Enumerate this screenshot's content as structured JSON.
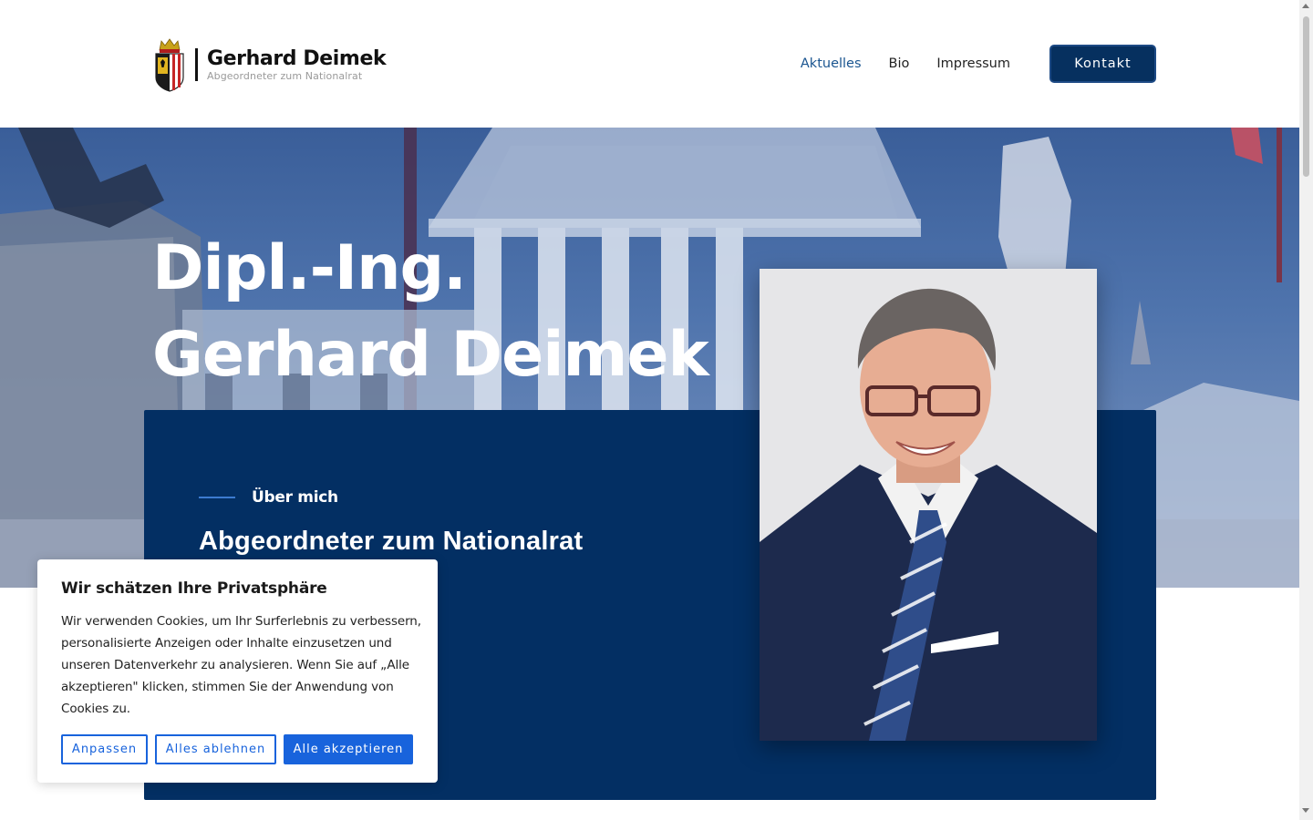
{
  "header": {
    "logo_name": "Gerhard Deimek",
    "logo_subtitle": "Abgeordneter zum Nationalrat",
    "nav": [
      {
        "label": "Aktuelles",
        "active": true
      },
      {
        "label": "Bio",
        "active": false
      },
      {
        "label": "Impressum",
        "active": false
      }
    ],
    "contact_label": "Kontakt"
  },
  "hero": {
    "title_line1": "Dipl.-Ing.",
    "title_line2": "Gerhard Deimek"
  },
  "about": {
    "label": "Über mich",
    "title": "Abgeordneter zum Nationalrat"
  },
  "cookie": {
    "title": "Wir schätzen Ihre Privatsphäre",
    "text": "Wir verwenden Cookies, um Ihr Surferlebnis zu verbessern, personalisierte Anzeigen oder Inhalte einzusetzen und unseren Datenverkehr zu analysieren. Wenn Sie auf „Alle akzeptieren\" klicken, stimmen Sie der Anwendung von Cookies zu.",
    "btn_customize": "Anpassen",
    "btn_reject": "Alles ablehnen",
    "btn_accept": "Alle akzeptieren"
  },
  "colors": {
    "primary_navy": "#032f63",
    "nav_active": "#1a5590",
    "cookie_accent": "#1863dc"
  },
  "icons": {
    "logo": "coat-of-arms-icon"
  }
}
